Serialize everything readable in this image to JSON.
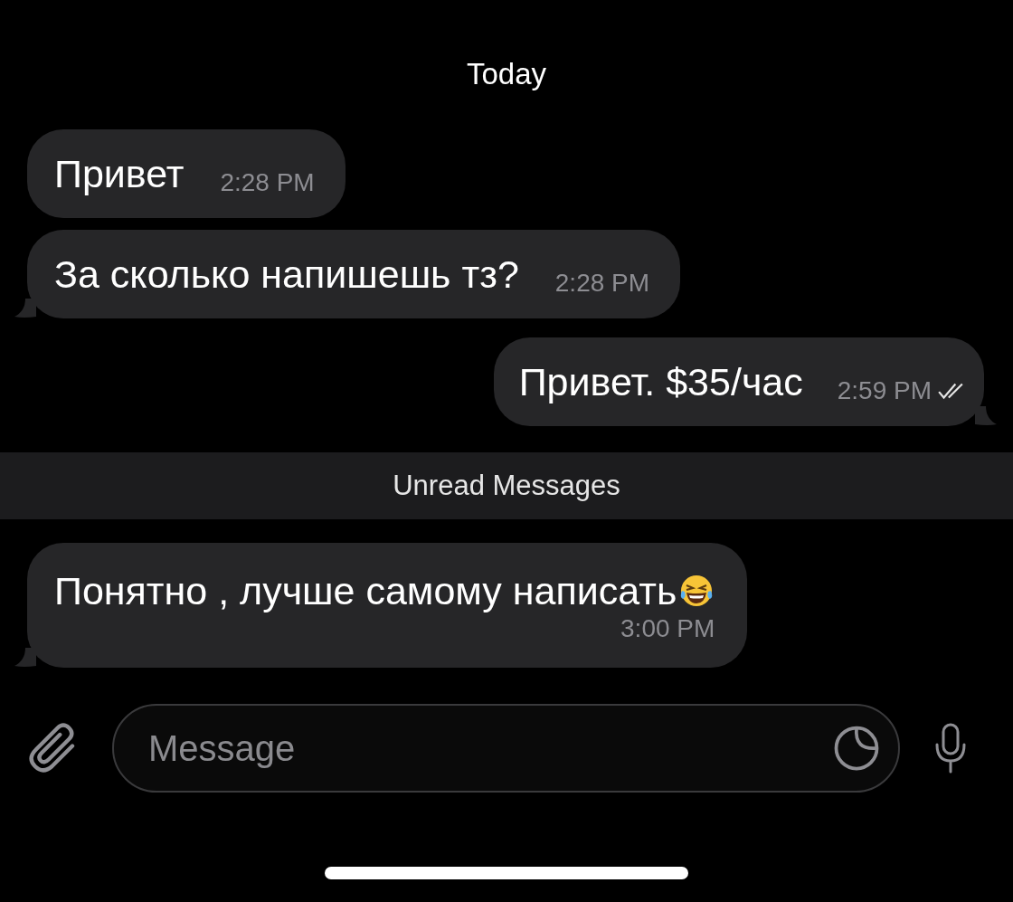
{
  "date_header": "Today",
  "messages": [
    {
      "kind": "incoming",
      "text": "Привет",
      "time": "2:28 PM",
      "tail": false,
      "read": false,
      "emoji": false,
      "time_on_new_line": false
    },
    {
      "kind": "incoming",
      "text": "За сколько напишешь тз?",
      "time": "2:28 PM",
      "tail": true,
      "read": false,
      "emoji": false,
      "time_on_new_line": false
    },
    {
      "kind": "outgoing",
      "text": "Привет. $35/час",
      "time": "2:59 PM",
      "tail": true,
      "read": true,
      "emoji": false,
      "time_on_new_line": false
    },
    {
      "kind": "unread_divider",
      "text": "Unread Messages"
    },
    {
      "kind": "incoming",
      "text": "Понятно , лучше самому написать",
      "time": "3:00 PM",
      "tail": true,
      "read": false,
      "emoji": true,
      "time_on_new_line": true
    }
  ],
  "composer": {
    "placeholder": "Message"
  }
}
